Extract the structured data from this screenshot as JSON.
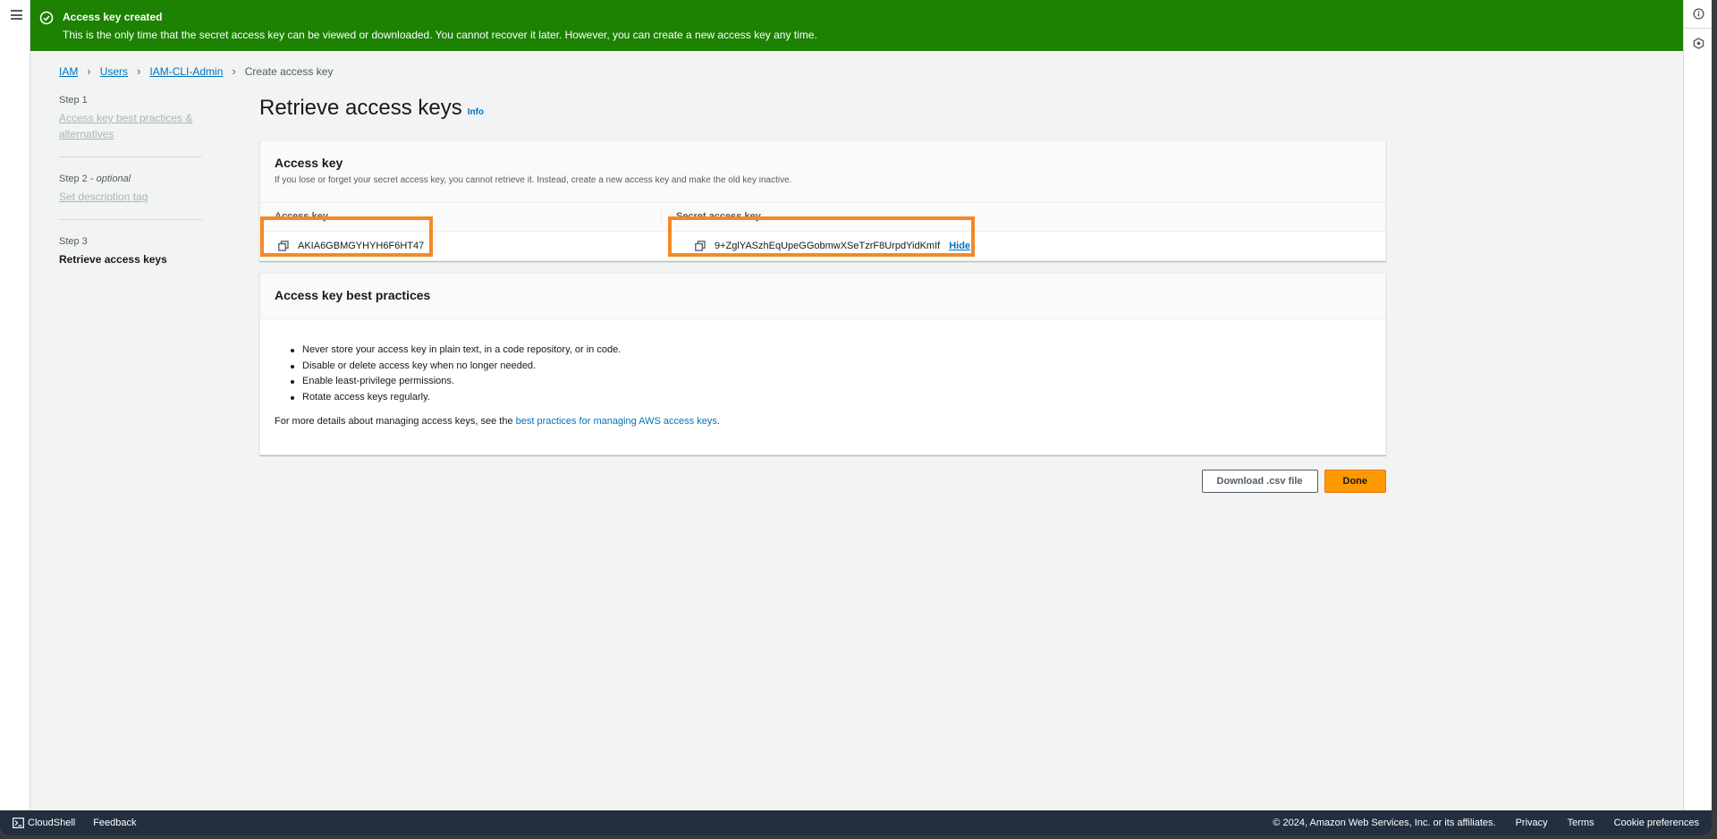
{
  "banner": {
    "title": "Access key created",
    "message": "This is the only time that the secret access key can be viewed or downloaded. You cannot recover it later. However, you can create a new access key any time.",
    "color": "#1d8102"
  },
  "breadcrumb": {
    "items": [
      "IAM",
      "Users",
      "IAM-CLI-Admin"
    ],
    "current": "Create access key"
  },
  "steps": [
    {
      "number": "Step 1",
      "label": "Access key best practices & alternatives"
    },
    {
      "number": "Step 2",
      "optional": "optional",
      "label": "Set description tag"
    },
    {
      "number": "Step 3",
      "label": "Retrieve access keys"
    }
  ],
  "page": {
    "title": "Retrieve access keys",
    "info_label": "Info"
  },
  "access_key_panel": {
    "title": "Access key",
    "description": "If you lose or forget your secret access key, you cannot retrieve it. Instead, create a new access key and make the old key inactive.",
    "columns": [
      "Access key",
      "Secret access key"
    ],
    "access_key_id": "AKIA6GBMGYHYH6F6HT47",
    "secret_access_key": "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",
    "hide_label": "Hide"
  },
  "best_practices_panel": {
    "title": "Access key best practices",
    "items": [
      "Never store your access key in plain text, in a code repository, or in code.",
      "Disable or delete access key when no longer needed.",
      "Enable least-privilege permissions.",
      "Rotate access keys regularly."
    ],
    "more_prefix": "For more details about managing access keys, see the ",
    "more_link": "best practices for managing AWS access keys",
    "more_suffix": "."
  },
  "actions": {
    "download_label": "Download .csv file",
    "done_label": "Done",
    "primary_color": "#ff9900"
  },
  "highlight_color": "#f68824",
  "footer": {
    "cloudshell": "CloudShell",
    "feedback": "Feedback",
    "copyright": "© 2024, Amazon Web Services, Inc. or its affiliates.",
    "privacy": "Privacy",
    "terms": "Terms",
    "cookies": "Cookie preferences"
  },
  "icons": {
    "menu": "hamburger-icon",
    "banner": "check-circle-icon",
    "info": "info-circle-icon",
    "settings": "hexagon-settings-icon",
    "copy": "copy-icon",
    "cloudshell": "terminal-icon"
  }
}
